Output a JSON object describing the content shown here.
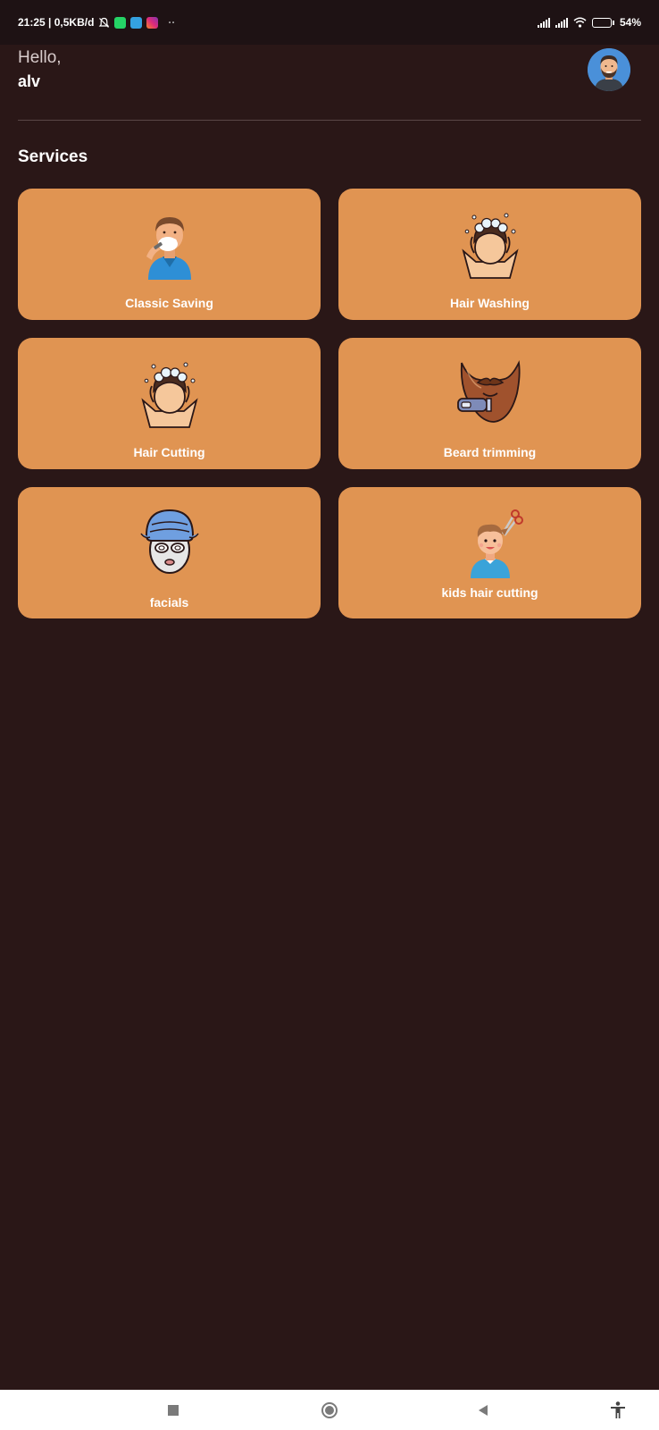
{
  "status_bar": {
    "time_info": "21:25 | 0,5KB/d",
    "more_indicator": "··",
    "battery_text": "54%",
    "battery_level": 0.54
  },
  "greeting": {
    "hello": "Hello,",
    "username": "alv"
  },
  "services": {
    "title": "Services",
    "items": [
      {
        "label": "Classic Saving",
        "icon": "shaving-man-icon"
      },
      {
        "label": "Hair Washing",
        "icon": "hair-washing-icon"
      },
      {
        "label": "Hair Cutting",
        "icon": "hair-washing-icon"
      },
      {
        "label": "Beard trimming",
        "icon": "beard-trimmer-icon"
      },
      {
        "label": "facials",
        "icon": "face-mask-icon"
      },
      {
        "label": "kids hair cutting",
        "icon": "kid-haircut-icon"
      }
    ]
  },
  "nav_bar": {
    "items": [
      "recents-icon",
      "home-icon",
      "back-icon",
      "accessibility-icon"
    ]
  },
  "colors": {
    "background": "#2a1717",
    "card": "#e09452",
    "status_bar": "#1e1214"
  }
}
